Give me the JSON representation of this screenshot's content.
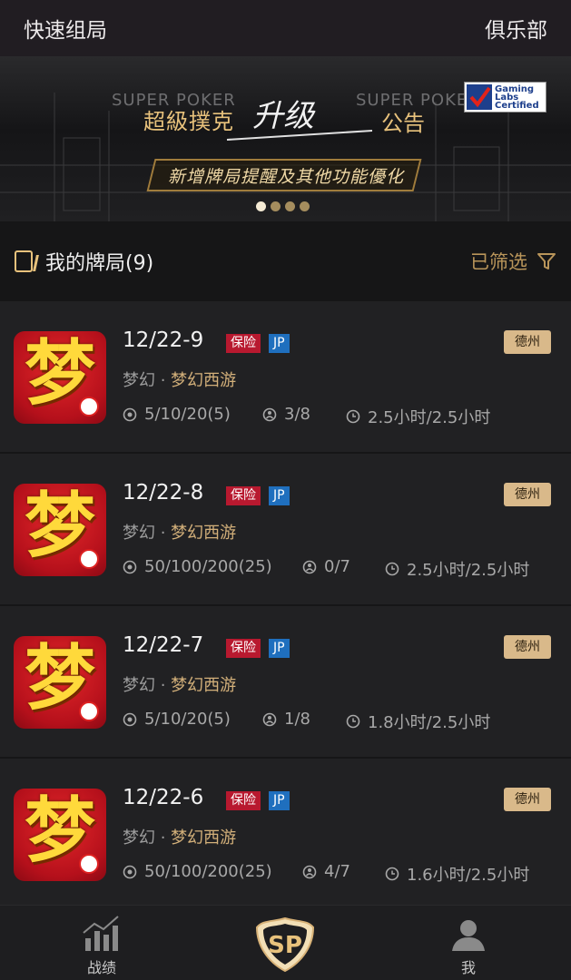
{
  "topbar": {
    "left_label": "快速组局",
    "right_label": "俱乐部"
  },
  "banner": {
    "brand_text": "SUPER POKER",
    "title": "超級撲克",
    "upgrade": "升级",
    "notice": "公告",
    "subtitle": "新增牌局提醒及其他功能優化",
    "badge_lines": [
      "Gaming",
      "Labs",
      "Certified"
    ],
    "page_count": 4,
    "active_page": 1
  },
  "section": {
    "heading": "我的牌局(9)",
    "filter_label": "已筛选"
  },
  "games": [
    {
      "title": "12/22-9",
      "tag_insurance": "保险",
      "tag_jp": "JP",
      "game_type": "德州",
      "club": "梦幻",
      "room": "梦幻西游",
      "blinds": "5/10/20(5)",
      "players": "3/8",
      "time": "2.5小时/2.5小时"
    },
    {
      "title": "12/22-8",
      "tag_insurance": "保险",
      "tag_jp": "JP",
      "game_type": "德州",
      "club": "梦幻",
      "room": "梦幻西游",
      "blinds": "50/100/200(25)",
      "players": "0/7",
      "time": "2.5小时/2.5小时"
    },
    {
      "title": "12/22-7",
      "tag_insurance": "保险",
      "tag_jp": "JP",
      "game_type": "德州",
      "club": "梦幻",
      "room": "梦幻西游",
      "blinds": "5/10/20(5)",
      "players": "1/8",
      "time": "1.8小时/2.5小时"
    },
    {
      "title": "12/22-6",
      "tag_insurance": "保险",
      "tag_jp": "JP",
      "game_type": "德州",
      "club": "梦幻",
      "room": "梦幻西游",
      "blinds": "50/100/200(25)",
      "players": "4/7",
      "time": "1.6小时/2.5小时"
    }
  ],
  "avatar_glyph": "梦",
  "tabs": [
    {
      "label": "战绩",
      "icon": "bar-chart-icon"
    },
    {
      "label": "",
      "icon": "sp-logo-icon"
    },
    {
      "label": "我",
      "icon": "user-icon"
    }
  ],
  "colors": {
    "accent_gold": "#e8c27c",
    "insurance_red": "#b8192f",
    "jp_blue": "#1f6fbe"
  }
}
